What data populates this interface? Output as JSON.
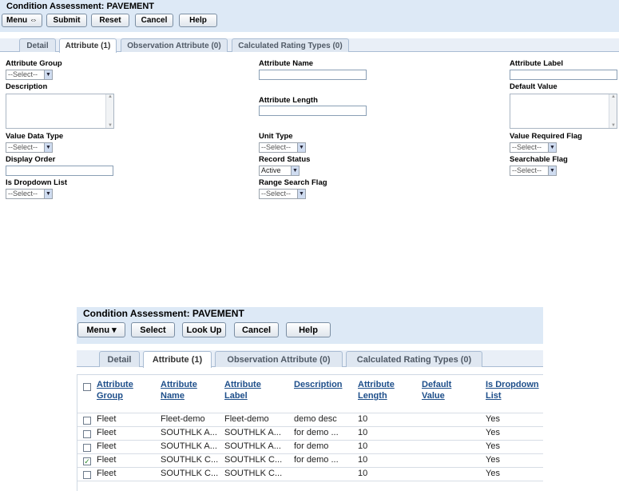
{
  "top": {
    "title": "Condition Assessment: PAVEMENT",
    "buttons": {
      "menu": "Menu ⇔",
      "submit": "Submit",
      "reset": "Reset",
      "cancel": "Cancel",
      "help": "Help"
    },
    "tabs": [
      "Detail",
      "Attribute (1)",
      "Observation Attribute (0)",
      "Calculated Rating Types (0)"
    ],
    "form": {
      "attribute_group": {
        "label": "Attribute Group",
        "value": "--Select--"
      },
      "attribute_name": {
        "label": "Attribute Name",
        "value": ""
      },
      "attribute_label": {
        "label": "Attribute Label",
        "value": ""
      },
      "description": {
        "label": "Description"
      },
      "attribute_length": {
        "label": "Attribute Length",
        "value": ""
      },
      "default_value": {
        "label": "Default Value"
      },
      "value_data_type": {
        "label": "Value Data Type",
        "value": "--Select--"
      },
      "unit_type": {
        "label": "Unit Type",
        "value": "--Select--"
      },
      "value_required_flag": {
        "label": "Value Required Flag",
        "value": "--Select--"
      },
      "display_order": {
        "label": "Display Order",
        "value": ""
      },
      "record_status": {
        "label": "Record Status",
        "value": "Active"
      },
      "searchable_flag": {
        "label": "Searchable Flag",
        "value": "--Select--"
      },
      "is_dropdown_list": {
        "label": "Is Dropdown List",
        "value": "--Select--"
      },
      "range_search_flag": {
        "label": "Range Search Flag",
        "value": "--Select--"
      }
    }
  },
  "bottom": {
    "title": "Condition Assessment: PAVEMENT",
    "buttons": {
      "menu": "Menu ▾",
      "select": "Select",
      "lookup": "Look Up",
      "cancel": "Cancel",
      "help": "Help"
    },
    "tabs": [
      "Detail",
      "Attribute (1)",
      "Observation Attribute (0)",
      "Calculated Rating Types (0)"
    ],
    "columns": [
      [
        "Attribute",
        "Group"
      ],
      [
        "Attribute",
        "Name"
      ],
      [
        "Attribute",
        "Label"
      ],
      [
        "Description",
        ""
      ],
      [
        "Attribute",
        "Length"
      ],
      [
        "Default",
        "Value"
      ],
      [
        "Is Dropdown",
        "List"
      ]
    ],
    "rows": [
      {
        "checked": false,
        "group": "Fleet",
        "name": "Fleet-demo",
        "label": "Fleet-demo",
        "desc": "demo desc",
        "length": "10",
        "default": "",
        "dropdown": "Yes"
      },
      {
        "checked": false,
        "group": "Fleet",
        "name": "SOUTHLK A...",
        "label": "SOUTHLK A...",
        "desc": "for demo ...",
        "length": "10",
        "default": "",
        "dropdown": "Yes"
      },
      {
        "checked": false,
        "group": "Fleet",
        "name": "SOUTHLK A...",
        "label": "SOUTHLK A...",
        "desc": "for demo",
        "length": "10",
        "default": "",
        "dropdown": "Yes"
      },
      {
        "checked": true,
        "group": "Fleet",
        "name": "SOUTHLK C...",
        "label": "SOUTHLK C...",
        "desc": "for demo ...",
        "length": "10",
        "default": "",
        "dropdown": "Yes"
      },
      {
        "checked": false,
        "group": "Fleet",
        "name": "SOUTHLK C...",
        "label": "SOUTHLK C...",
        "desc": "",
        "length": "10",
        "default": "",
        "dropdown": "Yes"
      }
    ]
  }
}
